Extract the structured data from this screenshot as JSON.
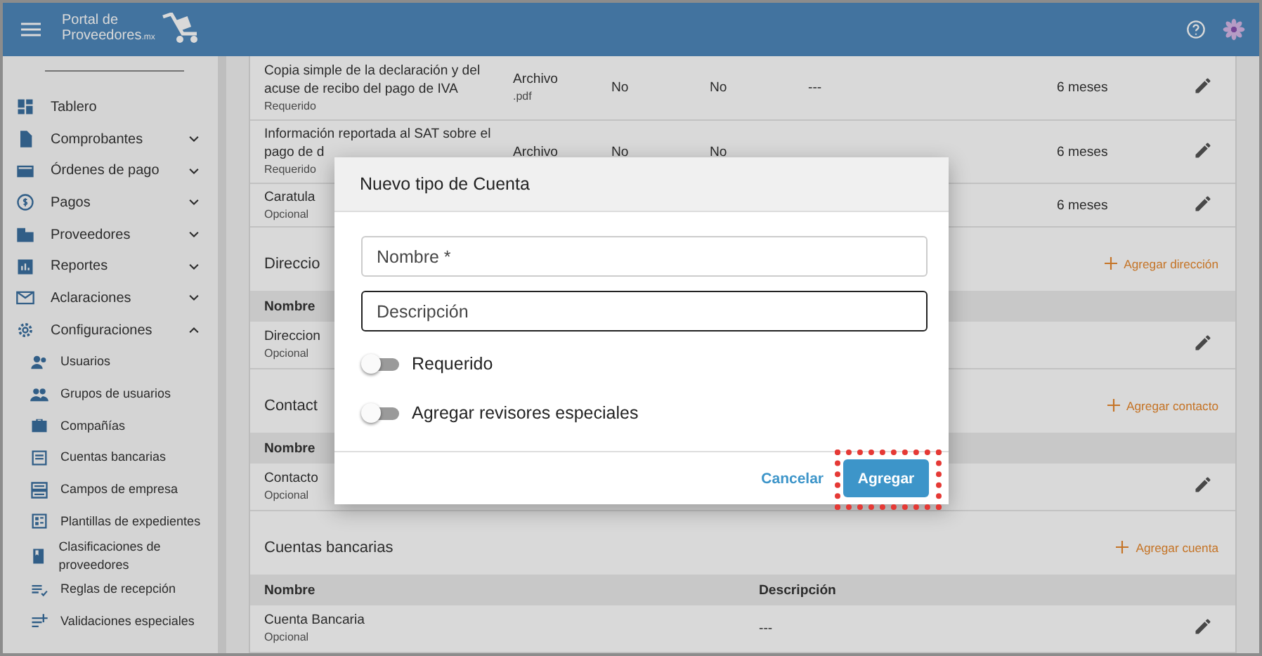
{
  "app_bar": {
    "logo_line_1": "Portal de",
    "logo_line_2": "Proveedores",
    "logo_suffix": ".mx"
  },
  "sidebar": {
    "items": [
      {
        "label": "Tablero",
        "kind": "link"
      },
      {
        "label": "Comprobantes",
        "kind": "group",
        "expanded": false
      },
      {
        "label": "Órdenes de pago",
        "kind": "group",
        "expanded": false
      },
      {
        "label": "Pagos",
        "kind": "group",
        "expanded": false
      },
      {
        "label": "Proveedores",
        "kind": "group",
        "expanded": false
      },
      {
        "label": "Reportes",
        "kind": "group",
        "expanded": false
      },
      {
        "label": "Aclaraciones",
        "kind": "group",
        "expanded": false
      },
      {
        "label": "Configuraciones",
        "kind": "group",
        "expanded": true,
        "children": [
          {
            "label": "Usuarios"
          },
          {
            "label": "Grupos de usuarios"
          },
          {
            "label": "Compañías"
          },
          {
            "label": "Cuentas bancarias"
          },
          {
            "label": "Campos de empresa"
          },
          {
            "label": "Plantillas de expedientes"
          },
          {
            "label": "Clasificaciones de proveedores"
          },
          {
            "label": "Reglas de recepción"
          },
          {
            "label": "Validaciones especiales"
          }
        ]
      }
    ]
  },
  "documents": {
    "rows": [
      {
        "name": "Copia simple de la declaración y del acuse de recibo del pago de IVA",
        "requirement": "Requerido",
        "type": "Archivo",
        "extension": ".pdf",
        "column_3": "No",
        "column_4": "No",
        "column_5": "---",
        "column_6": "6 meses"
      },
      {
        "name": "Información reportada al SAT sobre el pago de d",
        "requirement": "Requerido",
        "type": "Archivo",
        "column_3": "No",
        "column_4": "No",
        "column_6": "6 meses"
      },
      {
        "name": "Caratula",
        "requirement": "Opcional",
        "column_6": "6 meses"
      }
    ]
  },
  "sections": [
    {
      "title": "Direccio",
      "add_link": "Agregar dirección",
      "columns": [
        "Nombre"
      ],
      "rows": [
        {
          "name": "Direccion",
          "note": "Opcional"
        }
      ]
    },
    {
      "title": "Contact",
      "add_link": "Agregar contacto",
      "columns": [
        "Nombre"
      ],
      "rows": [
        {
          "name": "Contacto",
          "note": "Opcional"
        }
      ]
    },
    {
      "title": "Cuentas bancarias",
      "add_link": "Agregar cuenta",
      "columns": [
        "Nombre",
        "Descripción"
      ],
      "rows": [
        {
          "name": "Cuenta Bancaria",
          "note": "Opcional",
          "description": "---"
        }
      ]
    }
  ],
  "dialog": {
    "title": "Nuevo tipo de Cuenta",
    "fields": [
      {
        "placeholder": "Nombre *",
        "focused": false
      },
      {
        "placeholder": "Descripción",
        "focused": true
      }
    ],
    "toggles": [
      {
        "label": "Requerido",
        "on": false
      },
      {
        "label": "Agregar revisores especiales",
        "on": false
      }
    ],
    "cancel": "Cancelar",
    "confirm": "Agregar"
  }
}
